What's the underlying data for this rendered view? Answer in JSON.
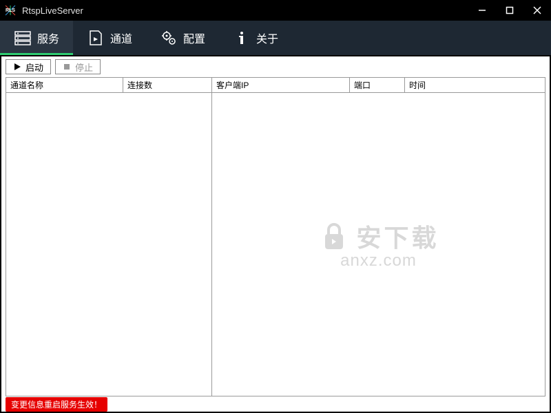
{
  "window": {
    "title": "RtspLiveServer"
  },
  "tabs": {
    "service": "服务",
    "channel": "通道",
    "config": "配置",
    "about": "关于"
  },
  "toolbar": {
    "start": "启动",
    "stop": "停止"
  },
  "left_table": {
    "columns": {
      "channel_name": "通道名称",
      "connections": "连接数"
    }
  },
  "right_table": {
    "columns": {
      "client_ip": "客户端IP",
      "port": "端口",
      "time": "时间"
    }
  },
  "status": {
    "message": "变更信息重启服务生效！"
  },
  "watermark": {
    "line1": "安下载",
    "line2": "anxz.com"
  }
}
